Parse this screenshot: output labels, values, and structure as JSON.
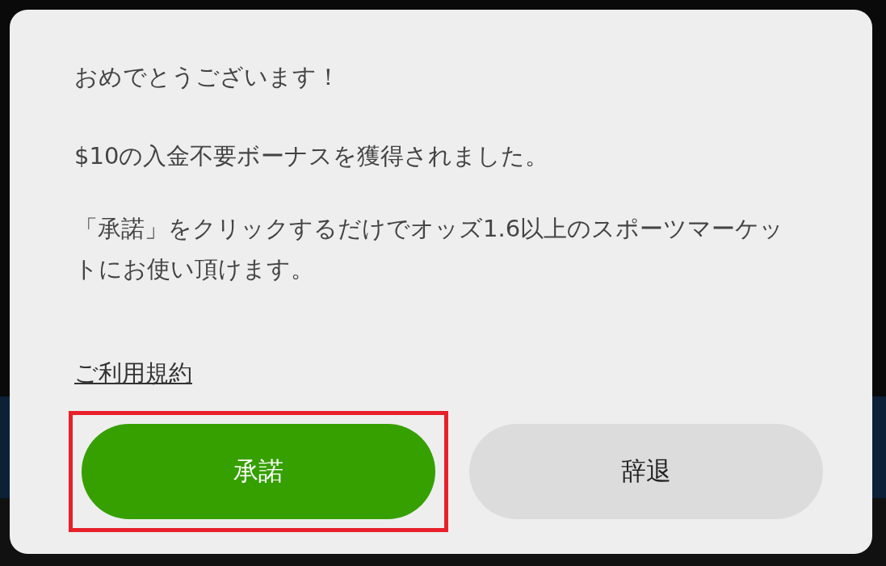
{
  "dialog": {
    "greeting": "おめでとうございます！",
    "message": "$10の入金不要ボーナスを獲得されました。",
    "instructions": "「承諾」をクリックするだけでオッズ1.6以上のスポーツマーケットにお使い頂けます。",
    "terms_link": "ご利用規約",
    "buttons": [
      {
        "label": "承諾",
        "kind": "primary",
        "highlighted": true
      },
      {
        "label": "辞退",
        "kind": "secondary",
        "highlighted": false
      }
    ]
  }
}
